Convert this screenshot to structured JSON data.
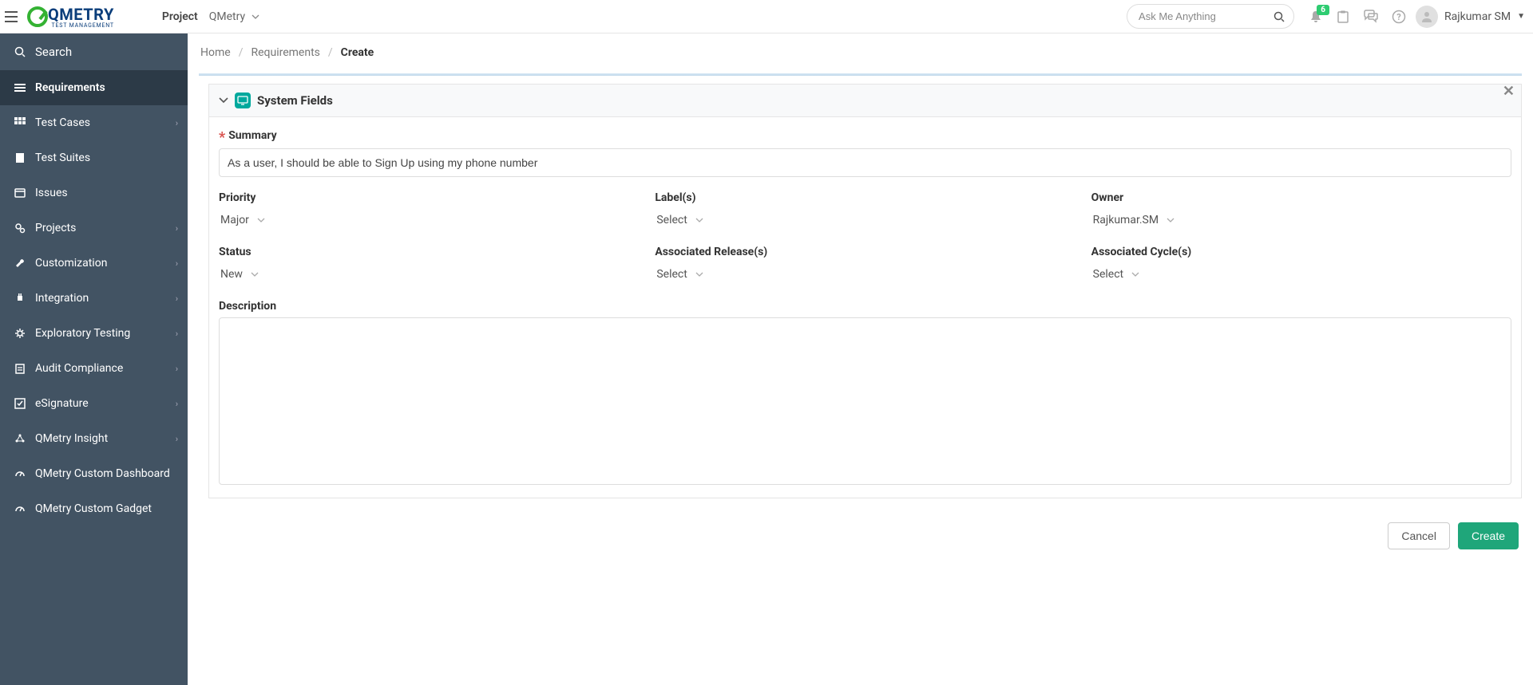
{
  "header": {
    "project_label": "Project",
    "project_value": "QMetry",
    "search_placeholder": "Ask Me Anything",
    "notification_count": "6",
    "user_name": "Rajkumar SM"
  },
  "logo": {
    "main": "QMETRY",
    "sub": "TEST MANAGEMENT"
  },
  "sidebar": {
    "search": "Search",
    "items": [
      {
        "label": "Requirements",
        "expandable": false
      },
      {
        "label": "Test Cases",
        "expandable": true
      },
      {
        "label": "Test Suites",
        "expandable": false
      },
      {
        "label": "Issues",
        "expandable": false
      },
      {
        "label": "Projects",
        "expandable": true
      },
      {
        "label": "Customization",
        "expandable": true
      },
      {
        "label": "Integration",
        "expandable": true
      },
      {
        "label": "Exploratory Testing",
        "expandable": true
      },
      {
        "label": "Audit Compliance",
        "expandable": true
      },
      {
        "label": "eSignature",
        "expandable": true
      },
      {
        "label": "QMetry Insight",
        "expandable": true
      },
      {
        "label": "QMetry Custom Dashboard",
        "expandable": false
      },
      {
        "label": "QMetry Custom Gadget",
        "expandable": false
      }
    ]
  },
  "breadcrumb": {
    "home": "Home",
    "mid": "Requirements",
    "current": "Create"
  },
  "section": {
    "title": "System Fields"
  },
  "form": {
    "summary_label": "Summary",
    "summary_value": "As a user, I should be able to Sign Up using my phone number",
    "priority_label": "Priority",
    "priority_value": "Major",
    "labels_label": "Label(s)",
    "labels_value": "Select",
    "owner_label": "Owner",
    "owner_value": "Rajkumar.SM",
    "status_label": "Status",
    "status_value": "New",
    "assoc_releases_label": "Associated Release(s)",
    "assoc_releases_value": "Select",
    "assoc_cycles_label": "Associated Cycle(s)",
    "assoc_cycles_value": "Select",
    "description_label": "Description"
  },
  "actions": {
    "cancel": "Cancel",
    "create": "Create"
  }
}
